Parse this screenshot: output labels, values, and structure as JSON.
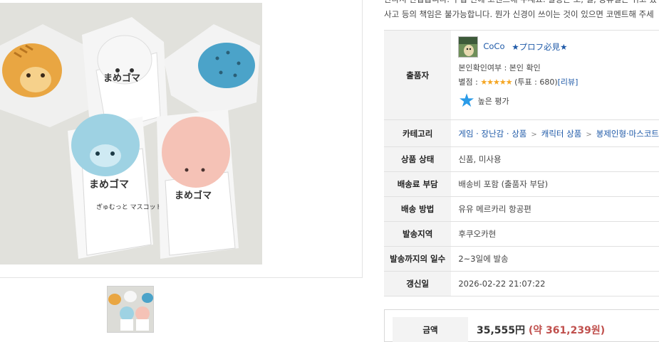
{
  "description": {
    "line1": "반나서 만갑습니다. 구입 전에 코멘트해 주세요. 발송은 토, 일, 공휴일은 쉬고 있",
    "line2": "사고 등의 책임은 불가능합니다. 뭔가 신경이 쓰이는 것이 있으면 코멘트해 주세"
  },
  "seller": {
    "label": "출품자",
    "name": "CoCo",
    "tag": "★プロフ必見★",
    "verification": "본인확인여부 : 본인 확인",
    "rating_prefix": "별점 : ",
    "stars": "★★★★★",
    "rating_votes": " (투표 : 680)",
    "review_link": "[리뷰]",
    "badge_label": "높은 평가",
    "star_count": 5,
    "accent_color": "#2a9be8"
  },
  "category": {
    "label": "카테고리",
    "path": [
      "게임 · 장난감 · 상품",
      "캐릭터 상품",
      "봉제인형·마스코트"
    ],
    "separator": ">"
  },
  "condition": {
    "label": "상품 상태",
    "value": "신품, 미사용"
  },
  "shipping_fee": {
    "label": "배송료 부담",
    "value": "배송비 포함 (출품자 부담)"
  },
  "shipping_method": {
    "label": "배송 방법",
    "value": "유유 메르카리 항공편"
  },
  "ship_from": {
    "label": "발송지역",
    "value": "후쿠오카현"
  },
  "days_to_ship": {
    "label": "발송까지의 일수",
    "value": "2~3일에 발송"
  },
  "updated": {
    "label": "갱신일",
    "value": "2026-02-22 21:07:22"
  },
  "price": {
    "label": "금액",
    "jpy": "35,555円",
    "krw": " (약 361,239원)",
    "krw_color": "#c0504d"
  },
  "images": {
    "main_alt": "mamegoma mascot figures photo",
    "thumb_count": 1,
    "package_text": "まめゴマ",
    "package_sub": "ぎゅむっと マスコット"
  }
}
